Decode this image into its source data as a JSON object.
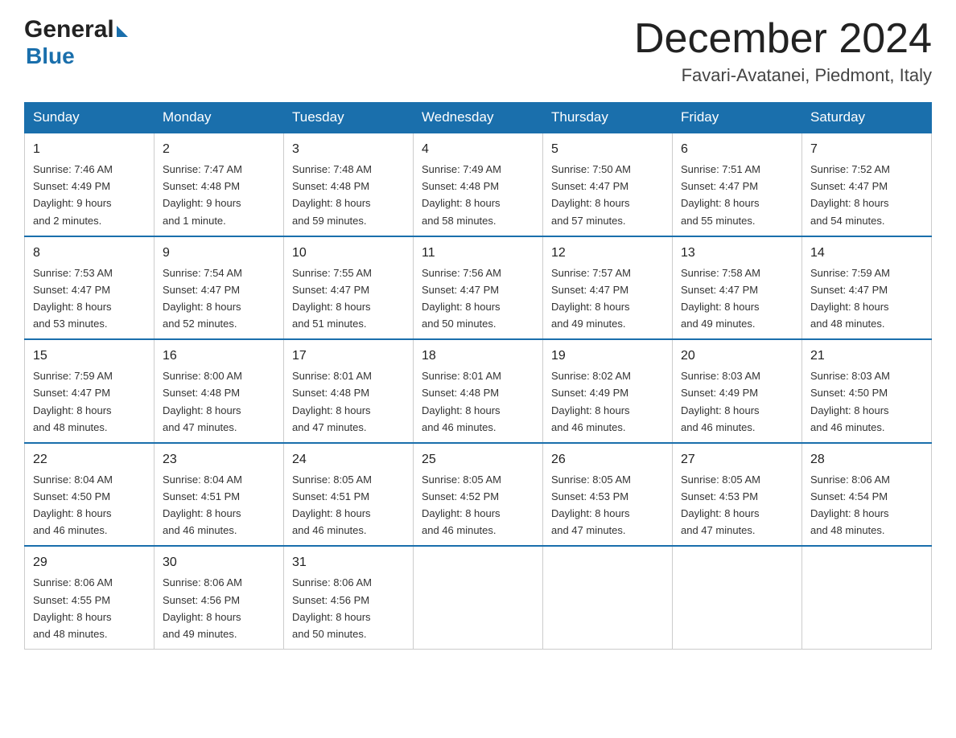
{
  "header": {
    "logo_general": "General",
    "logo_blue": "Blue",
    "month_title": "December 2024",
    "location": "Favari-Avatanei, Piedmont, Italy"
  },
  "days_of_week": [
    "Sunday",
    "Monday",
    "Tuesday",
    "Wednesday",
    "Thursday",
    "Friday",
    "Saturday"
  ],
  "weeks": [
    [
      {
        "day": "1",
        "sunrise": "7:46 AM",
        "sunset": "4:49 PM",
        "daylight": "9 hours and 2 minutes."
      },
      {
        "day": "2",
        "sunrise": "7:47 AM",
        "sunset": "4:48 PM",
        "daylight": "9 hours and 1 minute."
      },
      {
        "day": "3",
        "sunrise": "7:48 AM",
        "sunset": "4:48 PM",
        "daylight": "8 hours and 59 minutes."
      },
      {
        "day": "4",
        "sunrise": "7:49 AM",
        "sunset": "4:48 PM",
        "daylight": "8 hours and 58 minutes."
      },
      {
        "day": "5",
        "sunrise": "7:50 AM",
        "sunset": "4:47 PM",
        "daylight": "8 hours and 57 minutes."
      },
      {
        "day": "6",
        "sunrise": "7:51 AM",
        "sunset": "4:47 PM",
        "daylight": "8 hours and 55 minutes."
      },
      {
        "day": "7",
        "sunrise": "7:52 AM",
        "sunset": "4:47 PM",
        "daylight": "8 hours and 54 minutes."
      }
    ],
    [
      {
        "day": "8",
        "sunrise": "7:53 AM",
        "sunset": "4:47 PM",
        "daylight": "8 hours and 53 minutes."
      },
      {
        "day": "9",
        "sunrise": "7:54 AM",
        "sunset": "4:47 PM",
        "daylight": "8 hours and 52 minutes."
      },
      {
        "day": "10",
        "sunrise": "7:55 AM",
        "sunset": "4:47 PM",
        "daylight": "8 hours and 51 minutes."
      },
      {
        "day": "11",
        "sunrise": "7:56 AM",
        "sunset": "4:47 PM",
        "daylight": "8 hours and 50 minutes."
      },
      {
        "day": "12",
        "sunrise": "7:57 AM",
        "sunset": "4:47 PM",
        "daylight": "8 hours and 49 minutes."
      },
      {
        "day": "13",
        "sunrise": "7:58 AM",
        "sunset": "4:47 PM",
        "daylight": "8 hours and 49 minutes."
      },
      {
        "day": "14",
        "sunrise": "7:59 AM",
        "sunset": "4:47 PM",
        "daylight": "8 hours and 48 minutes."
      }
    ],
    [
      {
        "day": "15",
        "sunrise": "7:59 AM",
        "sunset": "4:47 PM",
        "daylight": "8 hours and 48 minutes."
      },
      {
        "day": "16",
        "sunrise": "8:00 AM",
        "sunset": "4:48 PM",
        "daylight": "8 hours and 47 minutes."
      },
      {
        "day": "17",
        "sunrise": "8:01 AM",
        "sunset": "4:48 PM",
        "daylight": "8 hours and 47 minutes."
      },
      {
        "day": "18",
        "sunrise": "8:01 AM",
        "sunset": "4:48 PM",
        "daylight": "8 hours and 46 minutes."
      },
      {
        "day": "19",
        "sunrise": "8:02 AM",
        "sunset": "4:49 PM",
        "daylight": "8 hours and 46 minutes."
      },
      {
        "day": "20",
        "sunrise": "8:03 AM",
        "sunset": "4:49 PM",
        "daylight": "8 hours and 46 minutes."
      },
      {
        "day": "21",
        "sunrise": "8:03 AM",
        "sunset": "4:50 PM",
        "daylight": "8 hours and 46 minutes."
      }
    ],
    [
      {
        "day": "22",
        "sunrise": "8:04 AM",
        "sunset": "4:50 PM",
        "daylight": "8 hours and 46 minutes."
      },
      {
        "day": "23",
        "sunrise": "8:04 AM",
        "sunset": "4:51 PM",
        "daylight": "8 hours and 46 minutes."
      },
      {
        "day": "24",
        "sunrise": "8:05 AM",
        "sunset": "4:51 PM",
        "daylight": "8 hours and 46 minutes."
      },
      {
        "day": "25",
        "sunrise": "8:05 AM",
        "sunset": "4:52 PM",
        "daylight": "8 hours and 46 minutes."
      },
      {
        "day": "26",
        "sunrise": "8:05 AM",
        "sunset": "4:53 PM",
        "daylight": "8 hours and 47 minutes."
      },
      {
        "day": "27",
        "sunrise": "8:05 AM",
        "sunset": "4:53 PM",
        "daylight": "8 hours and 47 minutes."
      },
      {
        "day": "28",
        "sunrise": "8:06 AM",
        "sunset": "4:54 PM",
        "daylight": "8 hours and 48 minutes."
      }
    ],
    [
      {
        "day": "29",
        "sunrise": "8:06 AM",
        "sunset": "4:55 PM",
        "daylight": "8 hours and 48 minutes."
      },
      {
        "day": "30",
        "sunrise": "8:06 AM",
        "sunset": "4:56 PM",
        "daylight": "8 hours and 49 minutes."
      },
      {
        "day": "31",
        "sunrise": "8:06 AM",
        "sunset": "4:56 PM",
        "daylight": "8 hours and 50 minutes."
      },
      null,
      null,
      null,
      null
    ]
  ],
  "labels": {
    "sunrise": "Sunrise:",
    "sunset": "Sunset:",
    "daylight": "Daylight:"
  }
}
